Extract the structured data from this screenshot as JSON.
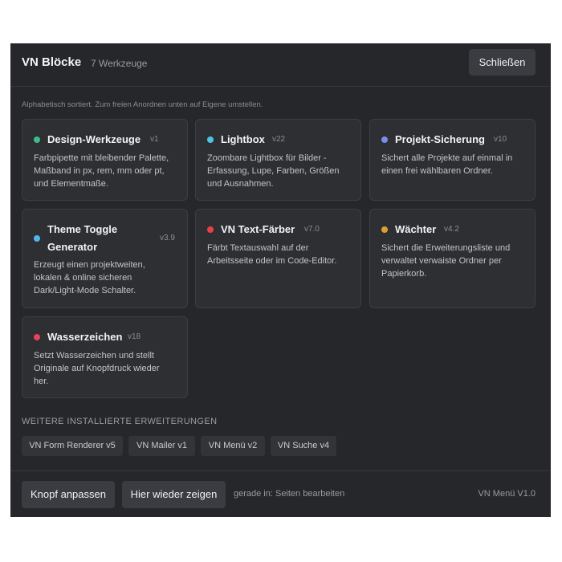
{
  "header": {
    "title": "VN Blöcke",
    "count": "7 Werkzeuge",
    "close_label": "Schließen"
  },
  "hint": "Alphabetisch sortiert. Zum freien Anordnen unten auf Eigene umstellen.",
  "cards": [
    {
      "name": "Design-Werkzeuge",
      "version": "v1",
      "dot_color": "#3dbb8a",
      "desc": [
        "Farbpipette mit bleibender Palette,",
        "Maßband in px, rem, mm oder pt,",
        "und Elementmaße."
      ]
    },
    {
      "name": "Lightbox",
      "version": "v22",
      "dot_color": "#4fc3e6",
      "desc": [
        "Zoombare Lightbox für Bilder -",
        "Erfassung, Lupe, Farben, Größen",
        "und Ausnahmen."
      ]
    },
    {
      "name": "Projekt-Sicherung",
      "version": "v10",
      "dot_color": "#7b8cf0",
      "desc": [
        "Sichert alle Projekte auf einmal in",
        "einen frei wählbaren Ordner."
      ]
    },
    {
      "name": [
        "Theme Toggle",
        "Generator"
      ],
      "version": "v3.9",
      "dot_color": "#4fb5f0",
      "desc": [
        "Erzeugt einen projektweiten,",
        "lokalen & online sicheren",
        "Dark/Light-Mode Schalter."
      ]
    },
    {
      "name": "VN Text-Färber",
      "version": "v7.0",
      "dot_color": "#e8414a",
      "desc": [
        "Färbt Textauswahl auf der",
        "Arbeitsseite oder im Code-Editor."
      ]
    },
    {
      "name": "Wächter",
      "version": "v4.2",
      "dot_color": "#e0a030",
      "desc": [
        "Sichert die Erweiterungsliste und",
        "verwaltet verwaiste Ordner per",
        "Papierkorb."
      ]
    },
    {
      "name": "Wasserzeichen",
      "version": "v18",
      "dot_color": "#e8415a",
      "desc": [
        "Setzt Wasserzeichen und stellt",
        "Originale auf Knopfdruck wieder",
        "her."
      ]
    }
  ],
  "more": {
    "title": "WEITERE INSTALLIERTE ERWEITERUNGEN",
    "chips": [
      "VN Form Renderer v5",
      "VN Mailer v1",
      "VN Menü v2",
      "VN Suche v4"
    ]
  },
  "footer": {
    "customize_label": "Knopf anpassen",
    "show_again_label": "Hier wieder zeigen",
    "status": "gerade in: Seiten bearbeiten",
    "version": "VN Menü V1.0"
  }
}
